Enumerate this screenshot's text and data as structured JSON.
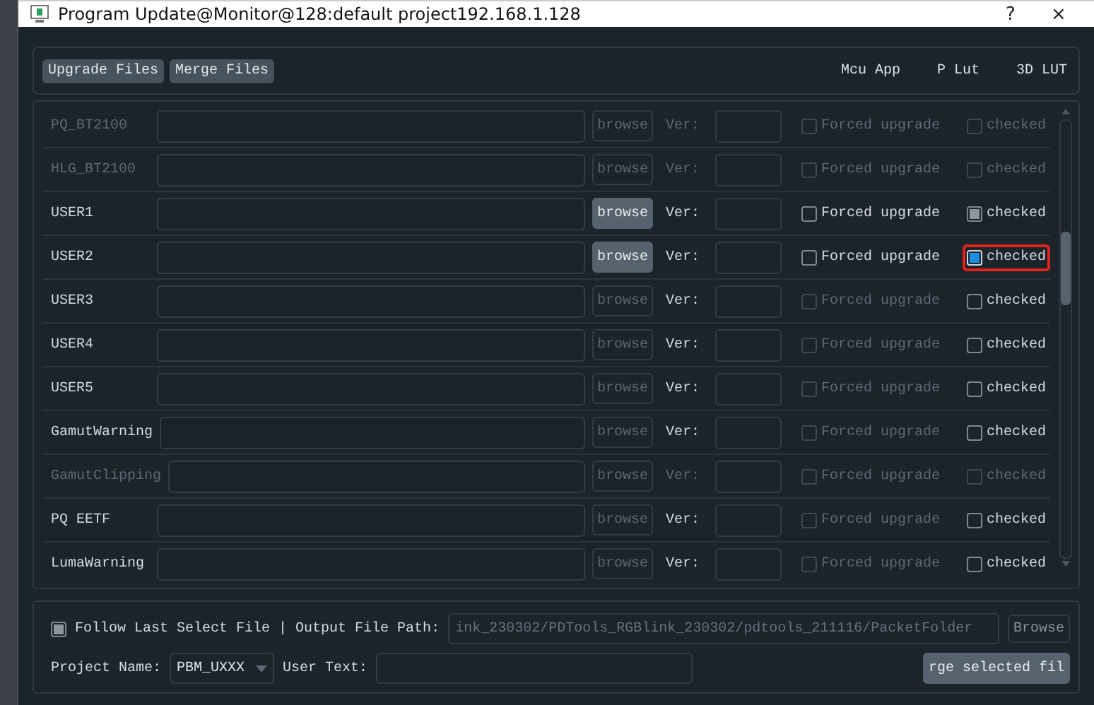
{
  "window": {
    "title": "Program Update@Monitor@128:default project192.168.1.128",
    "help": "?",
    "close": "×"
  },
  "toolbar": {
    "buttons": [
      {
        "label": "Upgrade Files"
      },
      {
        "label": "Merge Files"
      }
    ],
    "labels": [
      "Mcu App",
      "P Lut",
      "3D LUT"
    ]
  },
  "rows": [
    {
      "name": "PQ_BT2100",
      "enabled": false,
      "browse": "browse",
      "browse_enabled": false,
      "ver_label": "Ver:",
      "forced_label": "Forced upgrade",
      "forced_enabled": false,
      "forced": false,
      "checked_label": "checked",
      "checked": false,
      "focused": false,
      "highlighted": false
    },
    {
      "name": "HLG_BT2100",
      "enabled": false,
      "browse": "browse",
      "browse_enabled": false,
      "ver_label": "Ver:",
      "forced_label": "Forced upgrade",
      "forced_enabled": false,
      "forced": false,
      "checked_label": "checked",
      "checked": false,
      "focused": false,
      "highlighted": false
    },
    {
      "name": "USER1",
      "enabled": true,
      "browse": "browse",
      "browse_enabled": true,
      "ver_label": "Ver:",
      "forced_label": "Forced upgrade",
      "forced_enabled": true,
      "forced": false,
      "checked_label": "checked",
      "checked": true,
      "focused": false,
      "highlighted": false
    },
    {
      "name": "USER2",
      "enabled": true,
      "browse": "browse",
      "browse_enabled": true,
      "ver_label": "Ver:",
      "forced_label": "Forced upgrade",
      "forced_enabled": true,
      "forced": false,
      "checked_label": "checked",
      "checked": true,
      "focused": true,
      "highlighted": true
    },
    {
      "name": "USER3",
      "enabled": true,
      "browse": "browse",
      "browse_enabled": false,
      "ver_label": "Ver:",
      "forced_label": "Forced upgrade",
      "forced_enabled": false,
      "forced": false,
      "checked_label": "checked",
      "checked": false,
      "focused": false,
      "highlighted": false
    },
    {
      "name": "USER4",
      "enabled": true,
      "browse": "browse",
      "browse_enabled": false,
      "ver_label": "Ver:",
      "forced_label": "Forced upgrade",
      "forced_enabled": false,
      "forced": false,
      "checked_label": "checked",
      "checked": false,
      "focused": false,
      "highlighted": false
    },
    {
      "name": "USER5",
      "enabled": true,
      "browse": "browse",
      "browse_enabled": false,
      "ver_label": "Ver:",
      "forced_label": "Forced upgrade",
      "forced_enabled": false,
      "forced": false,
      "checked_label": "checked",
      "checked": false,
      "focused": false,
      "highlighted": false
    },
    {
      "name": "GamutWarning",
      "enabled": true,
      "browse": "browse",
      "browse_enabled": false,
      "ver_label": "Ver:",
      "forced_label": "Forced upgrade",
      "forced_enabled": false,
      "forced": false,
      "checked_label": "checked",
      "checked": false,
      "focused": false,
      "highlighted": false
    },
    {
      "name": "GamutClipping",
      "enabled": false,
      "browse": "browse",
      "browse_enabled": false,
      "ver_label": "Ver:",
      "forced_label": "Forced upgrade",
      "forced_enabled": false,
      "forced": false,
      "checked_label": "checked",
      "checked": false,
      "focused": false,
      "highlighted": false
    },
    {
      "name": "PQ EETF",
      "enabled": true,
      "browse": "browse",
      "browse_enabled": false,
      "ver_label": "Ver:",
      "forced_label": "Forced upgrade",
      "forced_enabled": false,
      "forced": false,
      "checked_label": "checked",
      "checked": false,
      "focused": false,
      "highlighted": false
    },
    {
      "name": "LumaWarning",
      "enabled": true,
      "browse": "browse",
      "browse_enabled": false,
      "ver_label": "Ver:",
      "forced_label": "Forced upgrade",
      "forced_enabled": false,
      "forced": false,
      "checked_label": "checked",
      "checked": false,
      "focused": false,
      "highlighted": false
    }
  ],
  "footer": {
    "follow_label": "Follow Last Select File",
    "follow_checked": true,
    "separator": "|",
    "output_label": "Output File Path:",
    "output_value": "ink_230302/PDTools_RGBlink_230302/pdtools_211116/PacketFolder",
    "browse": "Browse",
    "project_label": "Project Name:",
    "project_value": "PBM_UXXX",
    "user_text_label": "User Text:",
    "merge_button": "rge selected fil"
  }
}
